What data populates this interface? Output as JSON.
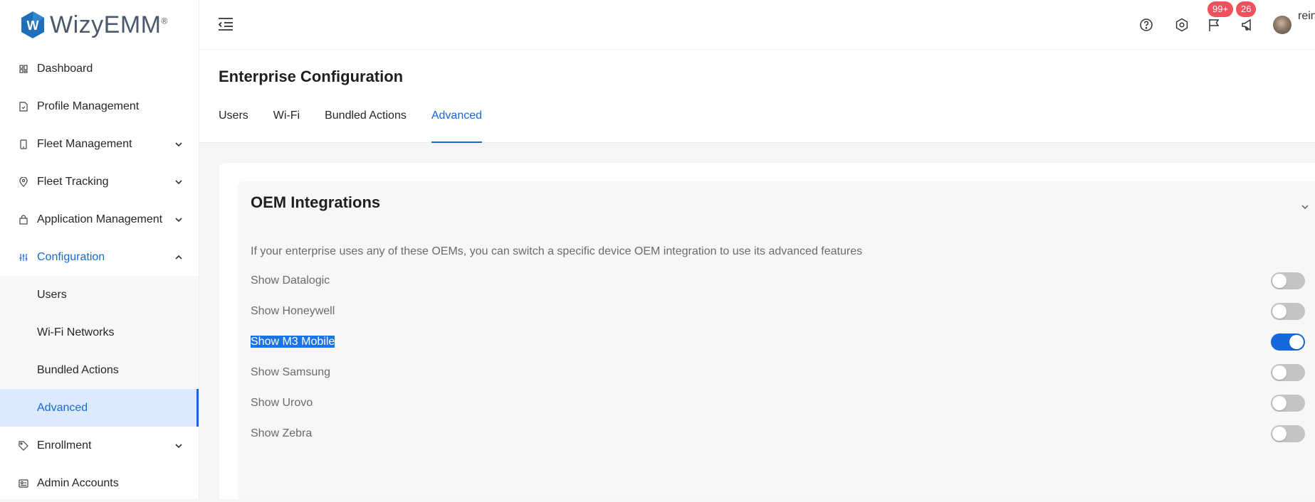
{
  "brand": {
    "name": "WizyEMM",
    "mark": "W",
    "registered": "®"
  },
  "colors": {
    "accent": "#1668dc",
    "badge": "#f0515c",
    "selected_bg": "#dbeafc"
  },
  "sidebar": {
    "items": [
      {
        "label": "Dashboard",
        "icon": "dashboard-icon"
      },
      {
        "label": "Profile Management",
        "icon": "file-icon"
      },
      {
        "label": "Fleet Management",
        "icon": "mobile-icon",
        "expandable": true
      },
      {
        "label": "Fleet Tracking",
        "icon": "location-pin-icon",
        "expandable": true
      },
      {
        "label": "Application Management",
        "icon": "shopping-bag-icon",
        "expandable": true
      },
      {
        "label": "Configuration",
        "icon": "sliders-icon",
        "expanded": true
      },
      {
        "label": "Enrollment",
        "icon": "tag-icon",
        "expandable": true
      },
      {
        "label": "Admin Accounts",
        "icon": "id-card-icon"
      }
    ],
    "config_sub": [
      {
        "label": "Users"
      },
      {
        "label": "Wi-Fi Networks"
      },
      {
        "label": "Bundled Actions"
      },
      {
        "label": "Advanced",
        "selected": true
      }
    ]
  },
  "header": {
    "icons": [
      "menu-fold-icon",
      "help-icon",
      "settings-icon",
      "flag-icon",
      "megaphone-icon"
    ],
    "flag_badge": "99+",
    "notice_badge": "26",
    "user_name": "rein"
  },
  "page": {
    "title": "Enterprise Configuration",
    "tabs": [
      "Users",
      "Wi-Fi",
      "Bundled Actions",
      "Advanced"
    ],
    "active_tab": "Advanced"
  },
  "panel": {
    "title": "OEM Integrations",
    "description": "If your enterprise uses any of these OEMs, you can switch a specific device OEM integration to use its advanced features",
    "toggles": [
      {
        "label": "Show Datalogic",
        "on": false
      },
      {
        "label": "Show Honeywell",
        "on": false
      },
      {
        "label": "Show M3 Mobile",
        "on": true,
        "highlighted": true
      },
      {
        "label": "Show Samsung",
        "on": false
      },
      {
        "label": "Show Urovo",
        "on": false
      },
      {
        "label": "Show Zebra",
        "on": false
      }
    ]
  }
}
